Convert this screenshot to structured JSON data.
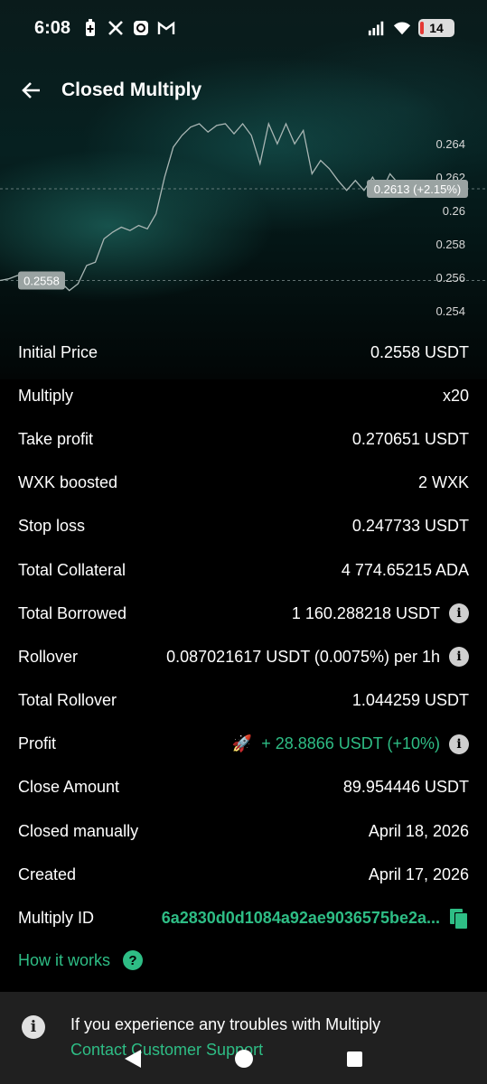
{
  "status_bar": {
    "time": "6:08",
    "battery": "14",
    "icons": [
      "battery-saver-icon",
      "x-logo-icon",
      "app-icon",
      "gmail-icon",
      "signal-icon",
      "wifi-icon"
    ]
  },
  "header": {
    "title": "Closed Multiply"
  },
  "chart_data": {
    "type": "line",
    "y_ticks": [
      "0.264",
      "0.262",
      "0.26",
      "0.258",
      "0.256",
      "0.254"
    ],
    "ylim": [
      0.2535,
      0.2652
    ],
    "entry_label": "0.2558",
    "exit_label": "0.2613 (+2.15%)",
    "entry_price": 0.2558,
    "exit_price": 0.2613,
    "values": [
      0.2558,
      0.2559,
      0.2561,
      0.2562,
      0.2563,
      0.2562,
      0.256,
      0.2557,
      0.2552,
      0.2556,
      0.2567,
      0.2569,
      0.2583,
      0.2587,
      0.259,
      0.2588,
      0.2591,
      0.2589,
      0.2598,
      0.262,
      0.2638,
      0.2645,
      0.265,
      0.2652,
      0.2647,
      0.2651,
      0.2652,
      0.2646,
      0.2652,
      0.2645,
      0.2628,
      0.2652,
      0.264,
      0.2652,
      0.264,
      0.2648,
      0.2622,
      0.263,
      0.2625,
      0.2618,
      0.2612,
      0.2618,
      0.2612,
      0.262,
      0.2611,
      0.2622,
      0.2616,
      0.2612,
      0.261,
      0.2613
    ]
  },
  "details": [
    {
      "label": "Initial Price",
      "value": "0.2558 USDT"
    },
    {
      "label": "Multiply",
      "value": "x20"
    },
    {
      "label": "Take profit",
      "value": "0.270651 USDT"
    },
    {
      "label": "WXK boosted",
      "value": "2 WXK"
    },
    {
      "label": "Stop loss",
      "value": "0.247733 USDT"
    },
    {
      "label": "Total Collateral",
      "value": "4 774.65215 ADA"
    },
    {
      "label": "Total Borrowed",
      "value": "1 160.288218 USDT"
    },
    {
      "label": "Rollover",
      "value": "0.087021617 USDT (0.0075%) per 1h"
    },
    {
      "label": "Total Rollover",
      "value": "1.044259 USDT"
    },
    {
      "label": "Profit",
      "value": "+ 28.8866 USDT (+10%)",
      "emoji": "🚀"
    },
    {
      "label": "Close Amount",
      "value": "89.954446 USDT"
    },
    {
      "label": "Closed manually",
      "value": "April 18, 2026"
    },
    {
      "label": "Created",
      "value": "April 17, 2026"
    },
    {
      "label": "Multiply ID",
      "value": "6a2830d0d1084a92ae9036575be2a..."
    }
  ],
  "info_symbol": "i",
  "how_it_works": {
    "label": "How it works",
    "icon_glyph": "?"
  },
  "footer": {
    "text": "If you experience any troubles with Multiply",
    "link": "Contact Customer Support",
    "icon_glyph": "i"
  },
  "colors": {
    "accent": "#2ebd85",
    "background": "#000000",
    "banner": "#202020"
  }
}
